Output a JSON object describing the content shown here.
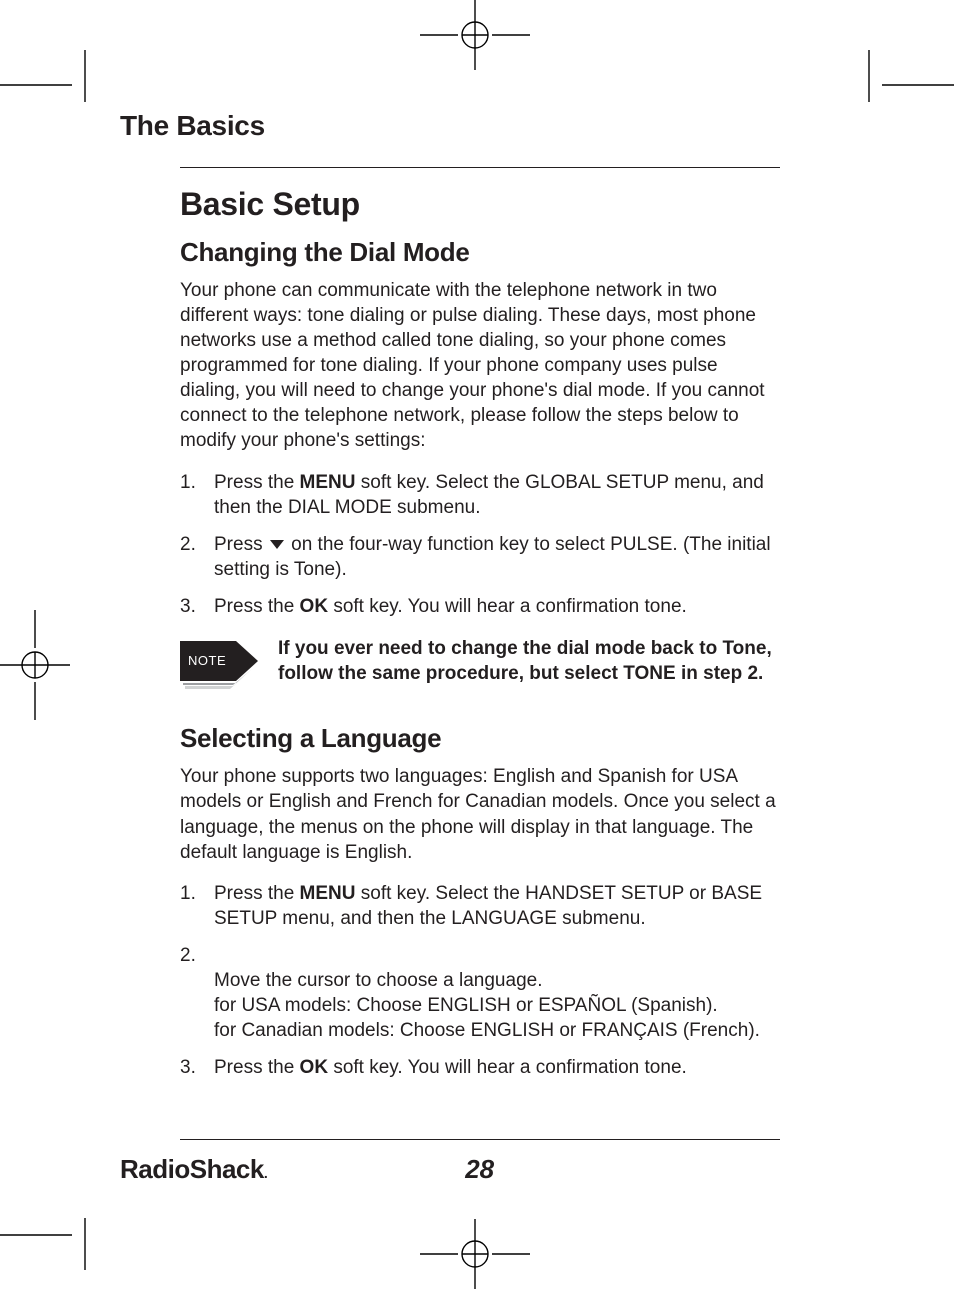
{
  "header": {
    "chapter": "The Basics"
  },
  "main": {
    "title": "Basic Setup",
    "dialmode": {
      "heading": "Changing the Dial Mode",
      "intro": "Your phone can communicate with the telephone network in two different ways: tone dialing or pulse dialing. These days, most phone networks use a method called tone dialing, so your phone comes programmed for tone dialing. If your phone company uses pulse dialing, you will need to change your phone's dial mode. If you cannot connect to the telephone network, please follow the steps below to modify your phone's settings:",
      "step1_a": "Press the ",
      "step1_b": "MENU",
      "step1_c": " soft key. Select the GLOBAL SETUP menu, and then the DIAL MODE submenu.",
      "step2_a": "Press ",
      "step2_b": " on the four-way function key to select PULSE. (The initial setting is Tone).",
      "step3_a": "Press the ",
      "step3_b": "OK",
      "step3_c": " soft key. You will hear a confirmation tone.",
      "note_label": "NOTE",
      "note_text": "If you ever need to change the dial mode back to Tone, follow the same procedure, but select TONE in step 2."
    },
    "language": {
      "heading": "Selecting a Language",
      "intro": "Your phone supports two languages: English and Spanish for USA models or English and French for Canadian models. Once you select a language, the menus on the phone will display in that language. The default language is English.",
      "step1_a": "Press the ",
      "step1_b": "MENU",
      "step1_c": " soft key. Select the HANDSET SETUP or BASE SETUP menu, and then the LANGUAGE submenu.",
      "step2": "Move the cursor to choose a language.\nfor USA models: Choose ENGLISH or ESPAÑOL (Spanish).\nfor Canadian models: Choose ENGLISH or FRANÇAIS (French).",
      "step3_a": "Press the ",
      "step3_b": "OK",
      "step3_c": " soft key. You will hear a confirmation tone."
    }
  },
  "footer": {
    "brand": "RadioShack",
    "brand_suffix": ".",
    "page": "28"
  }
}
